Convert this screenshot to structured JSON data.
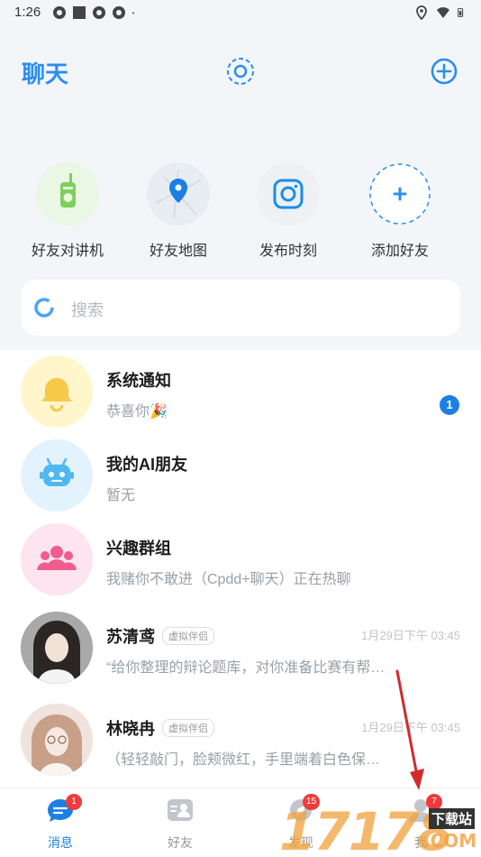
{
  "status": {
    "time": "1:26"
  },
  "header": {
    "title": "聊天"
  },
  "quick_actions": [
    {
      "label": "好友对讲机"
    },
    {
      "label": "好友地图"
    },
    {
      "label": "发布时刻"
    },
    {
      "label": "添加好友"
    }
  ],
  "search": {
    "placeholder": "搜索"
  },
  "chats": [
    {
      "name": "系统通知",
      "message": "恭喜你🎉",
      "unread": "1"
    },
    {
      "name": "我的AI朋友",
      "message": "暂无"
    },
    {
      "name": "兴趣群组",
      "message": "我赌你不敢进（Cpdd+聊天）正在热聊"
    },
    {
      "name": "苏清鸢",
      "tag": "虚拟伴侣",
      "message": "“给你整理的辩论题库，对你准备比赛有帮…",
      "time": "1月29日下午 03:45"
    },
    {
      "name": "林晓冉",
      "tag": "虚拟伴侣",
      "message": "（轻轻敲门，脸颊微红，手里端着白色保…",
      "time": "1月29日下午 03:45"
    }
  ],
  "bottom_nav": [
    {
      "label": "消息",
      "badge": "1",
      "active": true
    },
    {
      "label": "好友"
    },
    {
      "label": "发现",
      "badge": "15"
    },
    {
      "label": "我",
      "badge": "7"
    }
  ],
  "watermark": {
    "text": "17178",
    "sub": "下载站",
    "domain": ".COM"
  },
  "colors": {
    "accent": "#2a8ef0",
    "badge": "#ef3b3b",
    "unread": "#1b7fe5"
  }
}
